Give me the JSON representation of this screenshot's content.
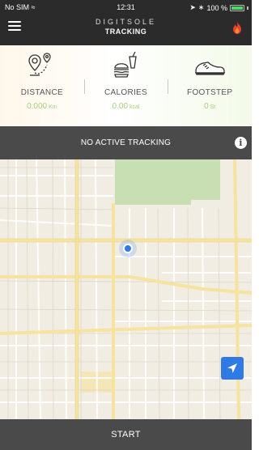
{
  "status_bar": {
    "carrier": "No SIM",
    "time": "12:31",
    "battery": "100 %",
    "battery_level": 1.0
  },
  "header": {
    "brand": "DIGITSOLE",
    "page_title": "TRACKING",
    "menu_icon": "hamburger-icon",
    "action_icon": "flame-icon"
  },
  "stats": [
    {
      "label": "DISTANCE",
      "value": "0.000",
      "unit": "Km",
      "icon": "route-pin-icon"
    },
    {
      "label": "CALORIES",
      "value": "0.00",
      "unit": "kcal",
      "icon": "burger-drink-icon"
    },
    {
      "label": "FOOTSTEP",
      "value": "0",
      "unit": "St",
      "icon": "sneaker-icon"
    }
  ],
  "tracking": {
    "status_text": "NO ACTIVE TRACKING",
    "info_glyph": "i"
  },
  "map": {
    "locate_icon": "location-arrow-icon"
  },
  "actions": {
    "start_label": "START"
  },
  "colors": {
    "header_bg": "#2b2b2b",
    "bar_bg": "#4a4a4a",
    "value_green": "#a5d27a",
    "accent_blue": "#2f7ae5",
    "flame": "#e8432a"
  }
}
